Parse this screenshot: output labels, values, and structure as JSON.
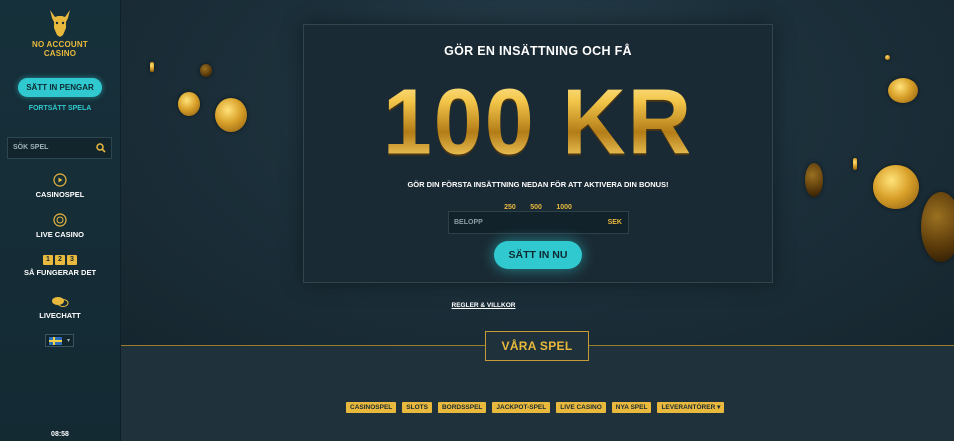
{
  "sidebar": {
    "logo_line1": "NO ACCOUNT",
    "logo_line2": "CASINO",
    "deposit_button": "SÄTT IN PENGAR",
    "continue_link": "FORTSÄTT SPELA",
    "search_placeholder": "SÖK SPEL",
    "nav": [
      {
        "label": "CASINOSPEL",
        "icon": "play-circle-icon"
      },
      {
        "label": "LIVE CASINO",
        "icon": "chip-icon"
      },
      {
        "label": "SÅ FUNGERAR DET",
        "icon": "steps-icon",
        "steps": [
          "1",
          "2",
          "3"
        ]
      },
      {
        "label": "LIVECHATT",
        "icon": "chat-bubbles-icon"
      }
    ],
    "language_flag": "sweden-flag-icon",
    "clock": "08:58"
  },
  "promo": {
    "title": "GÖR EN INSÄTTNING OCH FÅ",
    "amount": "100 KR",
    "subtitle": "GÖR DIN FÖRSTA INSÄTTNING NEDAN FÖR ATT AKTIVERA DIN BONUS!",
    "quick_amounts": [
      "250",
      "500",
      "1000"
    ],
    "amount_placeholder": "BELOPP",
    "currency": "SEK",
    "cta": "SÄTT IN NU",
    "rules_link": "REGLER & VILLKOR"
  },
  "games": {
    "section_title": "VÅRA SPEL",
    "filters": [
      "CASINOSPEL",
      "SLOTS",
      "BORDSSPEL",
      "JACKPOT-SPEL",
      "LIVE CASINO",
      "NYA SPEL",
      "LEVERANTÖRER"
    ],
    "providers_dropdown_caret": "▾"
  },
  "colors": {
    "accent_teal": "#2fc9cf",
    "gold": "#e8b93c",
    "background": "#1c2c36"
  }
}
